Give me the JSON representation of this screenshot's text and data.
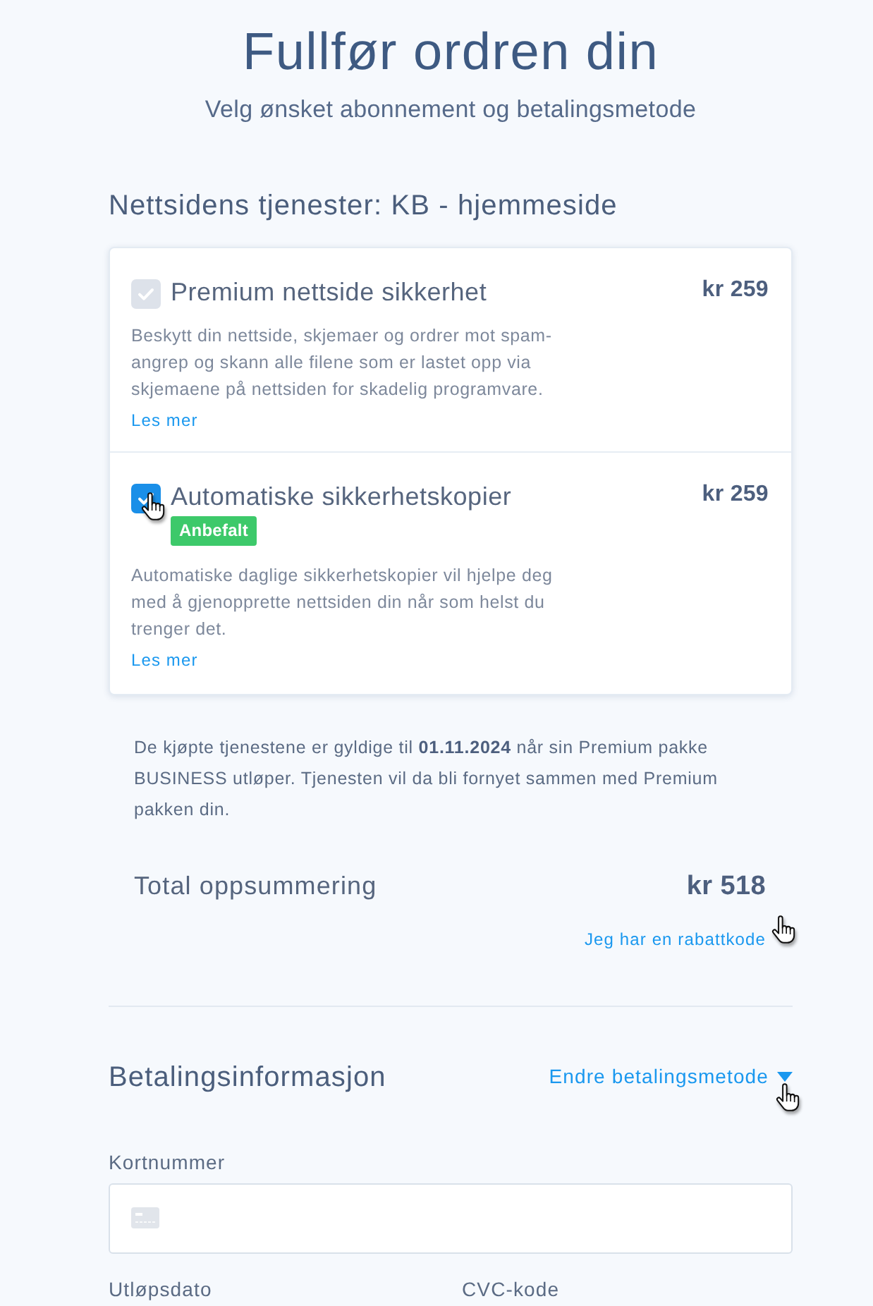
{
  "header": {
    "title": "Fullfør ordren din",
    "subtitle": "Velg ønsket abonnement og betalingsmetode"
  },
  "services": {
    "heading": "Nettsidens tjenester: KB - hjemmeside",
    "items": [
      {
        "name": "Premium nettside sikkerhet",
        "price": "kr 259",
        "checked": true,
        "disabled": true,
        "description": "Beskytt din nettside, skjemaer og ordrer mot spam-angrep og skann alle filene som er lastet opp via skjemaene på nettsiden for skadelig programvare.",
        "link": "Les mer"
      },
      {
        "name": "Automatiske sikkerhetskopier",
        "price": "kr 259",
        "checked": true,
        "disabled": false,
        "badge": "Anbefalt",
        "description": "Automatiske daglige sikkerhetskopier vil hjelpe deg med å gjenopprette nettsiden din når som helst du trenger det.",
        "link": "Les mer"
      }
    ]
  },
  "note": "De kjøpte tjenestene er gyldige til **01.11.2024** når sin Premium pakke BUSINESS utløper. Tjenesten vil da bli fornyet sammen med Premium pakken din.",
  "summary": {
    "label": "Total oppsummering",
    "total": "kr 518",
    "discount_link": "Jeg har en rabattkode"
  },
  "payment": {
    "heading": "Betalingsinformasjon",
    "change_method_link": "Endre betalingsmetode",
    "card_number": {
      "label": "Kortnummer"
    },
    "expiry": {
      "label": "Utløpsdato"
    },
    "cvc": {
      "label": "CVC-kode"
    }
  }
}
